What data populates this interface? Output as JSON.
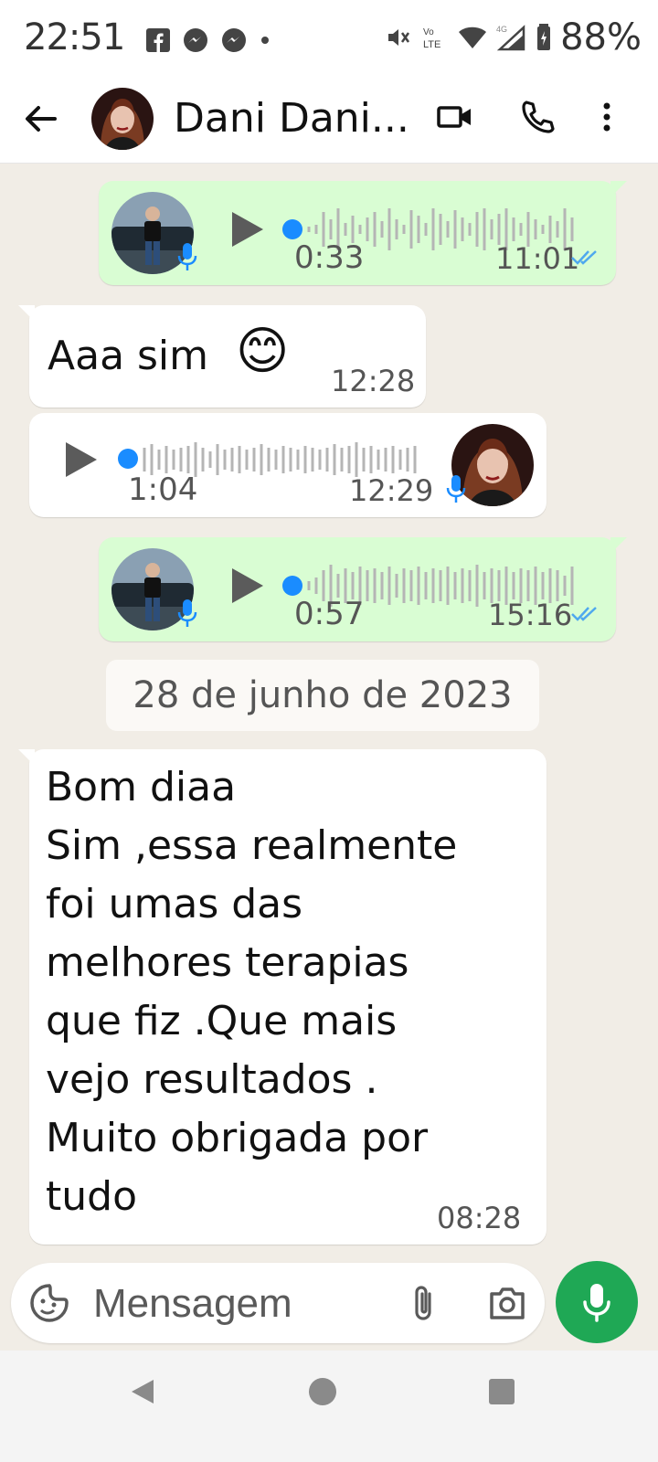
{
  "status_bar": {
    "time": "22:51",
    "battery": "88%",
    "notification_icons": [
      "facebook-icon",
      "messenger-icon",
      "messenger-icon",
      "dot-icon"
    ],
    "system_icons": [
      "mute-icon",
      "volte-icon",
      "wifi-icon",
      "signal-4g-icon",
      "battery-icon"
    ]
  },
  "header": {
    "contact_name": "Dani Dani...",
    "icons": [
      "back-arrow-icon",
      "video-call-icon",
      "phone-icon",
      "more-vert-icon"
    ]
  },
  "messages": [
    {
      "type": "voice",
      "direction": "out",
      "duration": "0:33",
      "time": "11:01",
      "status": "read"
    },
    {
      "type": "text",
      "direction": "in",
      "text": "Aaa sim",
      "emoji": "😊",
      "time": "12:28"
    },
    {
      "type": "voice",
      "direction": "in",
      "duration": "1:04",
      "time": "12:29"
    },
    {
      "type": "voice",
      "direction": "out",
      "duration": "0:57",
      "time": "15:16",
      "status": "read"
    },
    {
      "type": "date",
      "label": "28 de junho de 2023"
    },
    {
      "type": "text",
      "direction": "in",
      "lines": [
        "Bom diaa",
        "Sim ,essa realmente",
        "foi umas das",
        "melhores terapias",
        "que fiz .Que mais",
        "vejo resultados .",
        "Muito obrigada por",
        "tudo"
      ],
      "time": "08:28"
    }
  ],
  "composer": {
    "placeholder": "Mensagem",
    "icons": [
      "sticker-icon",
      "attach-icon",
      "camera-icon",
      "mic-icon"
    ]
  },
  "colors": {
    "chat_bg": "#f1ede6",
    "outgoing_bubble": "#d9fdd3",
    "incoming_bubble": "#ffffff",
    "accent_green": "#1fa855",
    "voice_dot_blue": "#1a8cff"
  }
}
